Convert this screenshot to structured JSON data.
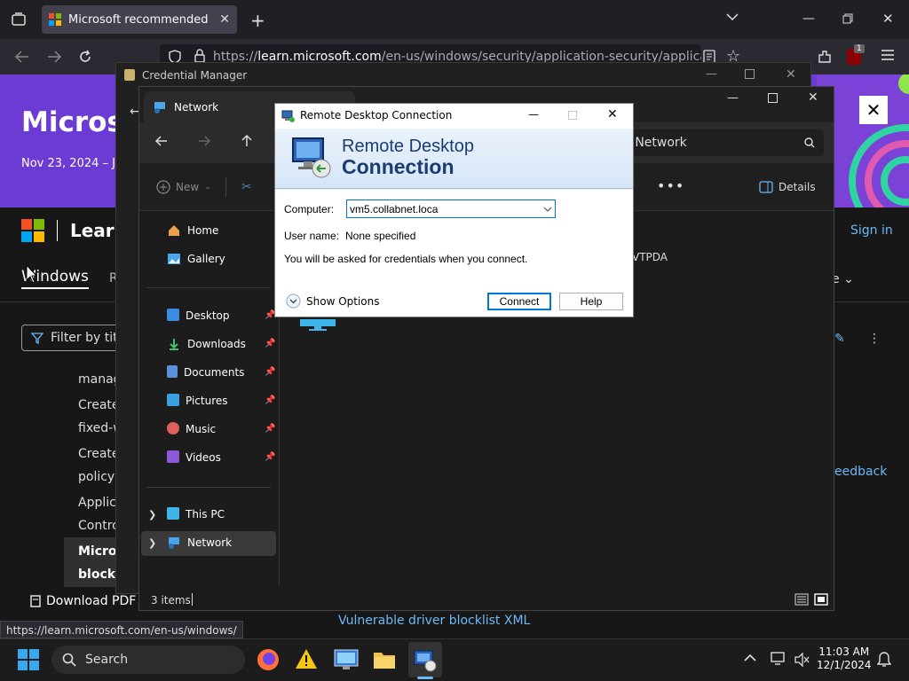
{
  "browser": {
    "tab_title": "Microsoft recommended driver",
    "url_prefix": "https://",
    "url_host": "learn.microsoft.com",
    "url_path": "/en-us/windows/security/application-security/application-con",
    "status_url": "https://learn.microsoft.com/en-us/windows/",
    "badge_count": "1"
  },
  "learn": {
    "hero_title": "Microso",
    "hero_date": "Nov 23, 2024 – J",
    "brand": "Learn",
    "signin": "Sign in",
    "tab_windows": "Windows",
    "tab_r": "R",
    "right_dropdown": "e",
    "filter_placeholder": "Filter by title",
    "toc": [
      "manag",
      "Create",
      "fixed-w",
      "Create",
      "policy",
      "Applica",
      "Contro",
      "Micros",
      "block r"
    ],
    "download_pdf": "Download PDF",
    "feedback": "eedback",
    "blocklist_link": "Vulnerable driver blocklist XML"
  },
  "credential_manager": {
    "title": "Credential Manager"
  },
  "explorer": {
    "tab_title": "Network",
    "search_text": "h Network",
    "new_label": "New",
    "details_label": "Details",
    "network_item": "VTPDA",
    "nav": {
      "home": "Home",
      "gallery": "Gallery",
      "desktop": "Desktop",
      "downloads": "Downloads",
      "documents": "Documents",
      "pictures": "Pictures",
      "music": "Music",
      "videos": "Videos",
      "this_pc": "This PC",
      "network": "Network"
    },
    "items_count": "3 items"
  },
  "rdp": {
    "title": "Remote Desktop Connection",
    "banner_line1": "Remote Desktop",
    "banner_line2": "Connection",
    "computer_label": "Computer:",
    "computer_value": "vm5.collabnet.loca",
    "username_label": "User name:",
    "username_value": "None specified",
    "info": "You will be asked for credentials when you connect.",
    "show_options": "Show Options",
    "connect": "Connect",
    "help": "Help"
  },
  "taskbar": {
    "search": "Search",
    "time": "11:03 AM",
    "date": "12/1/2024"
  },
  "colors": {
    "hero": "#6b3bd4",
    "link": "#6cb8f6",
    "rdp_banner_text": "#1a3c74",
    "accent": "#0078d7"
  }
}
